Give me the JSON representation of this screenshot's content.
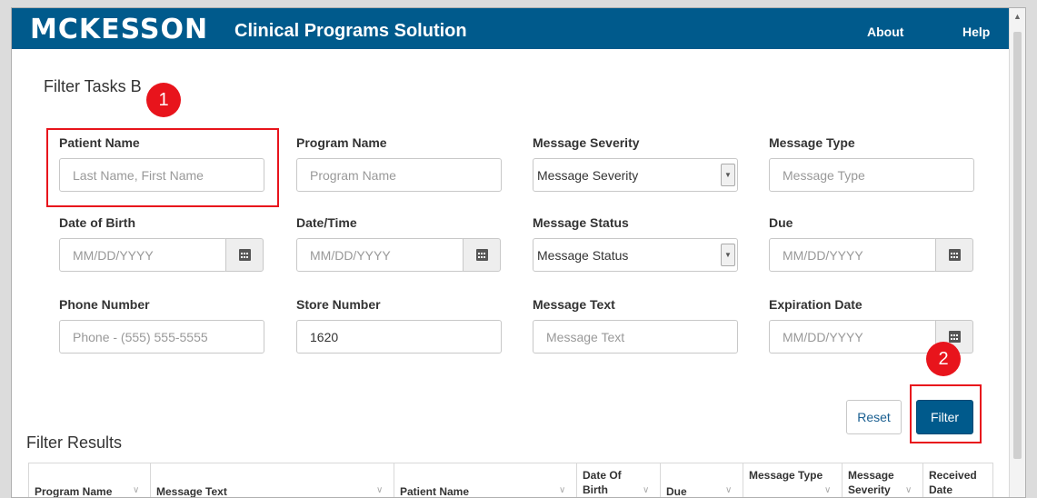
{
  "header": {
    "logo": "MCKESSON",
    "app_title": "Clinical Programs Solution",
    "nav": {
      "about": "About",
      "help": "Help"
    },
    "brand_color": "#005a8c"
  },
  "filter_section": {
    "title": "Filter Tasks B",
    "fields": {
      "patient_name": {
        "label": "Patient Name",
        "placeholder": "Last Name, First Name"
      },
      "program_name": {
        "label": "Program Name",
        "placeholder": "Program Name"
      },
      "message_severity": {
        "label": "Message Severity",
        "value": "Message Severity"
      },
      "message_type": {
        "label": "Message Type",
        "placeholder": "Message Type"
      },
      "date_of_birth": {
        "label": "Date of Birth",
        "placeholder": "MM/DD/YYYY"
      },
      "date_time": {
        "label": "Date/Time",
        "placeholder": "MM/DD/YYYY"
      },
      "message_status": {
        "label": "Message Status",
        "value": "Message Status"
      },
      "due": {
        "label": "Due",
        "placeholder": "MM/DD/YYYY"
      },
      "phone_number": {
        "label": "Phone Number",
        "placeholder": "Phone - (555) 555-5555"
      },
      "store_number": {
        "label": "Store Number",
        "value": "1620"
      },
      "message_text": {
        "label": "Message Text",
        "placeholder": "Message Text"
      },
      "expiration_date": {
        "label": "Expiration Date",
        "placeholder": "MM/DD/YYYY"
      }
    },
    "buttons": {
      "reset": "Reset",
      "filter": "Filter"
    }
  },
  "annotations": {
    "marker_1": "1",
    "marker_2": "2",
    "color": "#e8141c"
  },
  "results": {
    "title": "Filter Results",
    "columns": [
      {
        "label": "Program Name"
      },
      {
        "label": "Message Text"
      },
      {
        "label": "Patient Name"
      },
      {
        "label_line1": "Date Of",
        "label_line2": "Birth"
      },
      {
        "label": "Due"
      },
      {
        "label": "Message Type"
      },
      {
        "label_line1": "Message",
        "label_line2": "Severity"
      },
      {
        "label_line1": "Received",
        "label_line2": "Date"
      }
    ]
  },
  "icons": [
    "calendar-icon",
    "chevron-down-icon",
    "sort-icon"
  ]
}
